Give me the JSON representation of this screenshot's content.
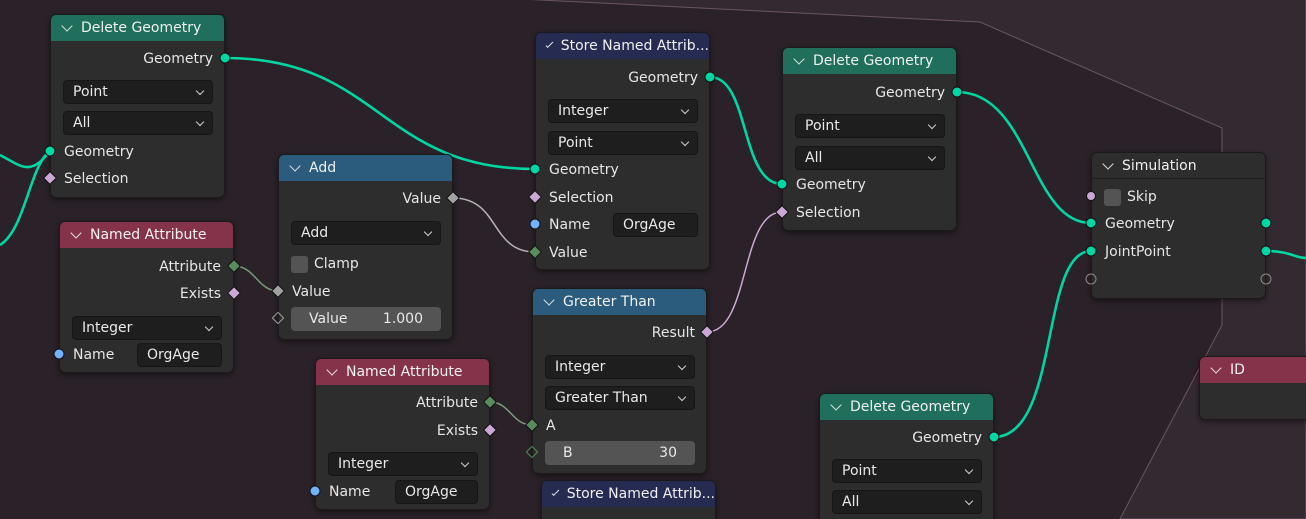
{
  "colors": {
    "background": "#2a2228",
    "frame": "#3a2e38",
    "geometry_link": "#00d6a3",
    "geometry_header": "#1f6f5c",
    "attribute_header": "#85334a",
    "math_header": "#2b5c7e",
    "store_header": "#262b52"
  },
  "nodes": {
    "delete_geometry_1": {
      "title": "Delete Geometry",
      "output_geometry": "Geometry",
      "domain": "Point",
      "mode": "All",
      "input_geometry": "Geometry",
      "input_selection": "Selection"
    },
    "named_attribute_1": {
      "title": "Named Attribute",
      "output_attribute": "Attribute",
      "output_exists": "Exists",
      "type": "Integer",
      "name_label": "Name",
      "name_value": "OrgAge"
    },
    "add": {
      "title": "Add",
      "output_value": "Value",
      "operation": "Add",
      "clamp_label": "Clamp",
      "input_value": "Value",
      "value_label": "Value",
      "value": "1.000"
    },
    "store_named_attribute_1": {
      "title": "Store Named Attrib...",
      "output_geometry": "Geometry",
      "type": "Integer",
      "domain": "Point",
      "input_geometry": "Geometry",
      "input_selection": "Selection",
      "name_label": "Name",
      "name_value": "OrgAge",
      "input_value": "Value"
    },
    "named_attribute_2": {
      "title": "Named Attribute",
      "output_attribute": "Attribute",
      "output_exists": "Exists",
      "type": "Integer",
      "name_label": "Name",
      "name_value": "OrgAge"
    },
    "greater_than": {
      "title": "Greater Than",
      "output_result": "Result",
      "type": "Integer",
      "operation": "Greater Than",
      "input_a": "A",
      "b_label": "B",
      "b_value": "30"
    },
    "store_named_attribute_2": {
      "title": "Store Named Attrib..."
    },
    "delete_geometry_2": {
      "title": "Delete Geometry",
      "output_geometry": "Geometry",
      "domain": "Point",
      "mode": "All",
      "input_geometry": "Geometry",
      "input_selection": "Selection"
    },
    "delete_geometry_3": {
      "title": "Delete Geometry",
      "output_geometry": "Geometry",
      "domain": "Point",
      "mode": "All"
    },
    "simulation": {
      "title": "Simulation",
      "skip_label": "Skip",
      "geometry": "Geometry",
      "joint_point": "JointPoint"
    },
    "id": {
      "title": "ID"
    }
  }
}
